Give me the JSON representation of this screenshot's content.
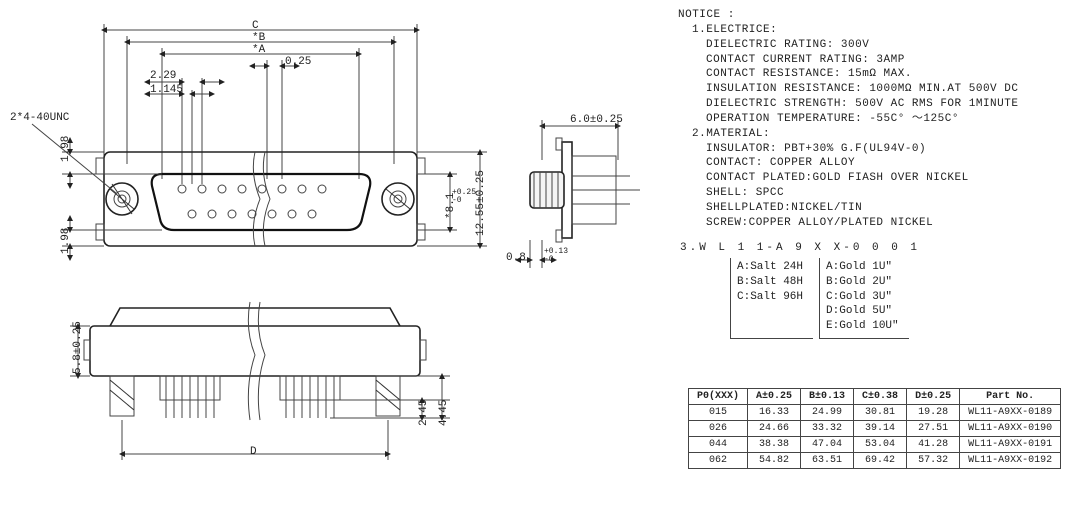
{
  "notice": {
    "header": "NOTICE :",
    "section1_title": "1.ELECTRICE:",
    "dielectric_rating": "DIELECTRIC RATING: 300V",
    "contact_current": "CONTACT CURRENT RATING: 3AMP",
    "contact_resistance": "CONTACT RESISTANCE: 15mΩ MAX.",
    "insulation_resistance": "INSULATION RESISTANCE: 1000MΩ MIN.AT 500V DC",
    "dielectric_strength": "DIELECTRIC STRENGTH: 500V AC RMS FOR 1MINUTE",
    "operation_temp": "OPERATION TEMPERATURE: -55C° ～125C°",
    "section2_title": "2.MATERIAL:",
    "insulator": "INSULATOR: PBT+30% G.F(UL94V-0)",
    "contact": "CONTACT: COPPER ALLOY",
    "contact_plated": "CONTACT PLATED:GOLD FIASH OVER NICKEL",
    "shell": "SHELL: SPCC",
    "shell_plated": "SHELLPLATED:NICKEL/TIN",
    "screw": "SCREW:COPPER ALLOY/PLATED NICKEL",
    "section3_title": "3.W L 1 1-A 9 X X-0 0 0 1",
    "salt_opts": [
      "A:Salt 24H",
      "B:Salt 48H",
      "C:Salt 96H"
    ],
    "gold_opts": [
      "A:Gold 1U\"",
      "B:Gold 2U\"",
      "C:Gold 3U\"",
      "D:Gold 5U\"",
      "E:Gold 10U\""
    ]
  },
  "dims": {
    "C": "C",
    "starB": "*B",
    "starA": "*A",
    "d025": "0.25",
    "d229": "2.29",
    "d1145": "1.145",
    "thread": "2*4-40UNC",
    "d198a": "1.98",
    "d198b": "1.98",
    "d81": "*8.1",
    "d81tol": "+0.25\n-0",
    "d1255": "12.55±0.25",
    "d60": "6.0±0.25",
    "d08": "0.8",
    "d08tol": "+0.13\n-0",
    "d58": "5.8±0.25",
    "d245": "2.45",
    "d445": "4.45",
    "D": "D"
  },
  "spec_table": {
    "headers": [
      "P0(XXX)",
      "A±0.25",
      "B±0.13",
      "C±0.38",
      "D±0.25",
      "Part  No."
    ],
    "rows": [
      [
        "015",
        "16.33",
        "24.99",
        "30.81",
        "19.28",
        "WL11-A9XX-0189"
      ],
      [
        "026",
        "24.66",
        "33.32",
        "39.14",
        "27.51",
        "WL11-A9XX-0190"
      ],
      [
        "044",
        "38.38",
        "47.04",
        "53.04",
        "41.28",
        "WL11-A9XX-0191"
      ],
      [
        "062",
        "54.82",
        "63.51",
        "69.42",
        "57.32",
        "WL11-A9XX-0192"
      ]
    ]
  }
}
